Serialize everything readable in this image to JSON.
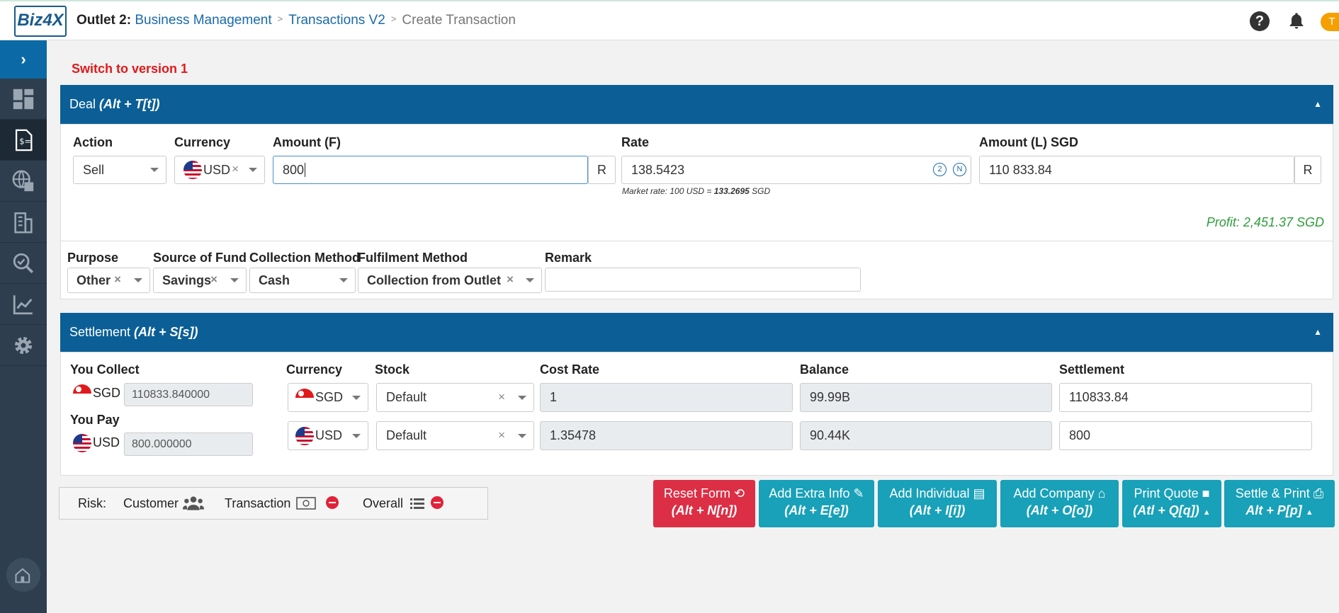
{
  "app": {
    "logo": "Biz4X",
    "avatar": "T"
  },
  "breadcrumb": {
    "outlet": "Outlet 2:",
    "section": "Business Management",
    "page": "Transactions V2",
    "current": "Create Transaction"
  },
  "switch_link": "Switch to version 1",
  "deal": {
    "title": "Deal ",
    "shortcut": "(Alt + T[t])",
    "action": {
      "label": "Action",
      "value": "Sell"
    },
    "currency": {
      "label": "Currency",
      "value": "USD"
    },
    "amount_f": {
      "label": "Amount (F)",
      "value": "800",
      "btn": "R"
    },
    "rate": {
      "label": "Rate",
      "value": "138.5423",
      "ind1": "2",
      "ind2": "N"
    },
    "market_rate": {
      "prefix": "Market rate: 100 USD = ",
      "value": "133.2695",
      "suffix": " SGD"
    },
    "amount_l": {
      "label": "Amount (L) SGD",
      "value": "110 833.84",
      "btn": "R"
    },
    "profit": "Profit: 2,451.37 SGD",
    "purpose": {
      "label": "Purpose",
      "value": "Other"
    },
    "source_of_fund": {
      "label": "Source of Fund",
      "value": "Savings"
    },
    "collection_method": {
      "label": "Collection Method",
      "value": "Cash"
    },
    "fulfilment_method": {
      "label": "Fulfilment Method",
      "value": "Collection from Outlet"
    },
    "remark": {
      "label": "Remark",
      "value": ""
    }
  },
  "settlement": {
    "title": "Settlement ",
    "shortcut": "(Alt + S[s])",
    "headers": {
      "you_collect": "You Collect",
      "you_pay": "You Pay",
      "currency": "Currency",
      "stock": "Stock",
      "cost_rate": "Cost Rate",
      "balance": "Balance",
      "settlement": "Settlement"
    },
    "rows": [
      {
        "cur": "SGD",
        "amount": "110833.840000",
        "currency": "SGD",
        "stock": "Default",
        "cost_rate": "1",
        "balance": "99.99B",
        "settlement": "110833.84"
      },
      {
        "cur": "USD",
        "amount": "800.000000",
        "currency": "USD",
        "stock": "Default",
        "cost_rate": "1.35478",
        "balance": "90.44K",
        "settlement": "800"
      }
    ]
  },
  "risk": {
    "label": "Risk:",
    "customer": "Customer",
    "transaction": "Transaction",
    "overall": "Overall"
  },
  "buttons": [
    {
      "label": "Reset Form",
      "key": "(Alt + N[n])"
    },
    {
      "label": "Add Extra Info",
      "key": "(Alt + E[e])"
    },
    {
      "label": "Add Individual",
      "key": "(Alt + I[i])"
    },
    {
      "label": "Add Company",
      "key": "(Alt + O[o])"
    },
    {
      "label": "Print Quote",
      "key": "(Atl + Q[q])"
    },
    {
      "label": "Settle & Print",
      "key": "Alt + P[p]"
    }
  ],
  "colors": {
    "primary": "#0b5f96",
    "teal": "#18a1b8",
    "danger": "#dc2f45",
    "profit": "#2e9e3a"
  }
}
